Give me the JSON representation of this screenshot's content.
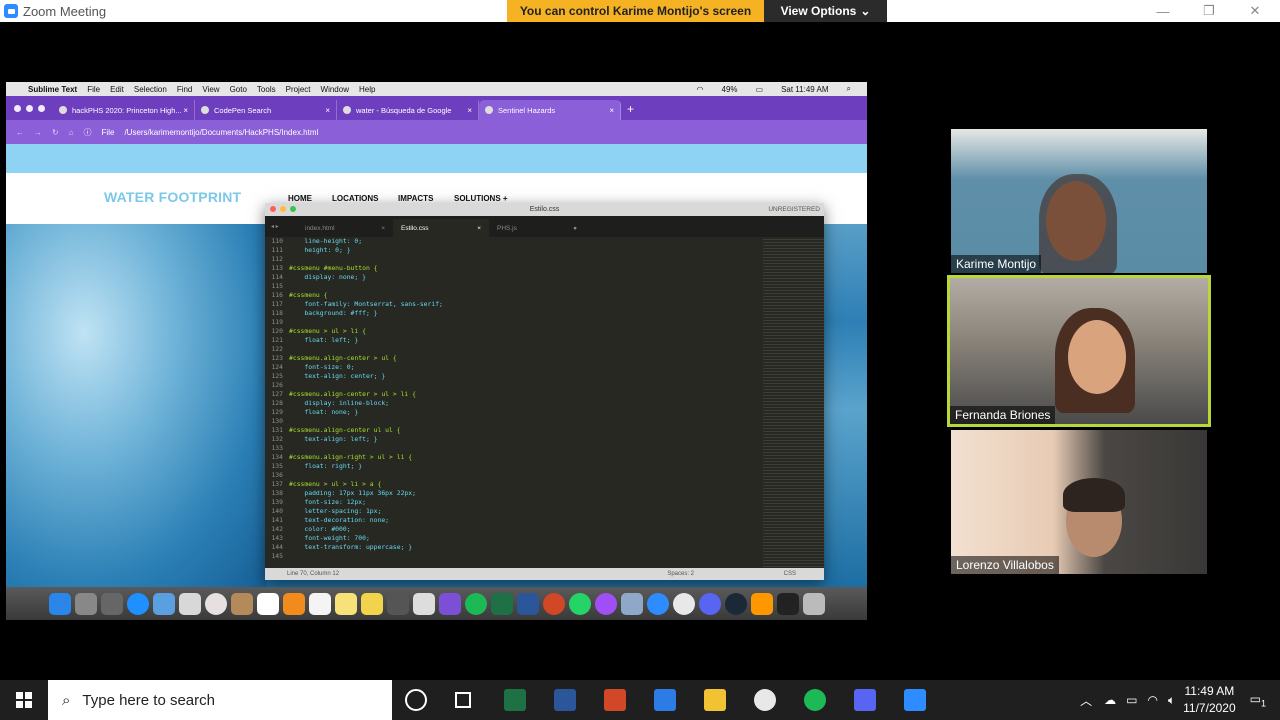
{
  "zoom": {
    "window_title": "Zoom Meeting",
    "share_banner": "You can control Karime Montijo's screen",
    "view_options": "View Options",
    "chevron": "⌄"
  },
  "mac": {
    "menubar": {
      "app": "Sublime Text",
      "items": [
        "File",
        "Edit",
        "Selection",
        "Find",
        "View",
        "Goto",
        "Tools",
        "Project",
        "Window",
        "Help"
      ],
      "battery": "49%",
      "clock": "Sat 11:49 AM"
    },
    "chrome": {
      "tabs": [
        {
          "label": "hackPHS 2020: Princeton High..."
        },
        {
          "label": "CodePen Search"
        },
        {
          "label": "water - Búsqueda de Google"
        },
        {
          "label": "Sentinel Hazards"
        }
      ],
      "address_prefix": "File",
      "address": "/Users/karimemontijo/Documents/HackPHS/Index.html"
    },
    "site": {
      "logo": "WATER FOOTPRINT",
      "nav": [
        "HOME",
        "LOCATIONS",
        "IMPACTS",
        "SOLUTIONS +"
      ]
    },
    "sublime": {
      "title": "Estilo.css",
      "unregistered": "UNREGISTERED",
      "tabs": [
        "index.html",
        "Estilo.css",
        "PHS.js"
      ],
      "status_left": "Line 70, Column 12",
      "status_spaces": "Spaces: 2",
      "status_syntax": "CSS",
      "lines": [
        {
          "no": "110",
          "text": "    line-height: 0;"
        },
        {
          "no": "111",
          "text": "    height: 0; }"
        },
        {
          "no": "112",
          "text": ""
        },
        {
          "no": "113",
          "text": "#cssmenu #menu-button {"
        },
        {
          "no": "114",
          "text": "    display: none; }"
        },
        {
          "no": "115",
          "text": ""
        },
        {
          "no": "116",
          "text": "#cssmenu {"
        },
        {
          "no": "117",
          "text": "    font-family: Montserrat, sans-serif;"
        },
        {
          "no": "118",
          "text": "    background: #fff; }"
        },
        {
          "no": "119",
          "text": ""
        },
        {
          "no": "120",
          "text": "#cssmenu > ul > li {"
        },
        {
          "no": "121",
          "text": "    float: left; }"
        },
        {
          "no": "122",
          "text": ""
        },
        {
          "no": "123",
          "text": "#cssmenu.align-center > ul {"
        },
        {
          "no": "124",
          "text": "    font-size: 0;"
        },
        {
          "no": "125",
          "text": "    text-align: center; }"
        },
        {
          "no": "126",
          "text": ""
        },
        {
          "no": "127",
          "text": "#cssmenu.align-center > ul > li {"
        },
        {
          "no": "128",
          "text": "    display: inline-block;"
        },
        {
          "no": "129",
          "text": "    float: none; }"
        },
        {
          "no": "130",
          "text": ""
        },
        {
          "no": "131",
          "text": "#cssmenu.align-center ul ul {"
        },
        {
          "no": "132",
          "text": "    text-align: left; }"
        },
        {
          "no": "133",
          "text": ""
        },
        {
          "no": "134",
          "text": "#cssmenu.align-right > ul > li {"
        },
        {
          "no": "135",
          "text": "    float: right; }"
        },
        {
          "no": "136",
          "text": ""
        },
        {
          "no": "137",
          "text": "#cssmenu > ul > li > a {"
        },
        {
          "no": "138",
          "text": "    padding: 17px 11px 36px 22px;"
        },
        {
          "no": "139",
          "text": "    font-size: 12px;"
        },
        {
          "no": "140",
          "text": "    letter-spacing: 1px;"
        },
        {
          "no": "141",
          "text": "    text-decoration: none;"
        },
        {
          "no": "142",
          "text": "    color: #000;"
        },
        {
          "no": "143",
          "text": "    font-weight: 700;"
        },
        {
          "no": "144",
          "text": "    text-transform: uppercase; }"
        },
        {
          "no": "145",
          "text": ""
        }
      ]
    }
  },
  "participants": [
    {
      "name": "Karime Montijo"
    },
    {
      "name": "Fernanda Briones"
    },
    {
      "name": "Lorenzo Villalobos"
    }
  ],
  "taskbar": {
    "search_placeholder": "Type here to search",
    "time": "11:49 AM",
    "date": "11/7/2020",
    "notifications": "1"
  },
  "colors": {
    "accent_banner": "#f5b324",
    "speaker_border": "#b8d738",
    "chrome_purple": "#6d3fbf"
  }
}
